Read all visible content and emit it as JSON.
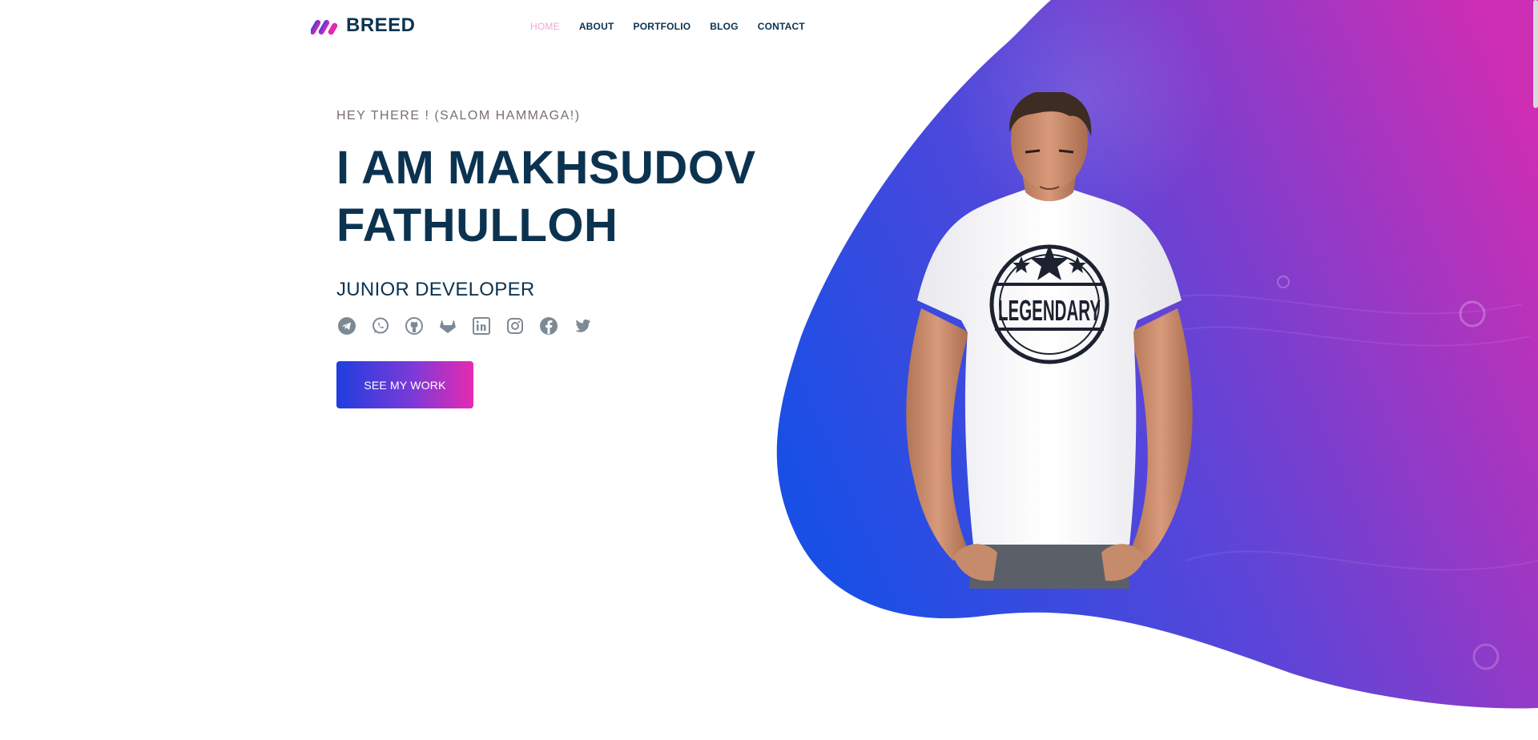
{
  "brand": {
    "name": "BREED",
    "logo_icon": "brand-logo-icon"
  },
  "nav": {
    "items": [
      {
        "label": "HOME",
        "active": true
      },
      {
        "label": "ABOUT",
        "active": false
      },
      {
        "label": "PORTFOLIO",
        "active": false
      },
      {
        "label": "BLOG",
        "active": false
      },
      {
        "label": "CONTACT",
        "active": false
      }
    ]
  },
  "hero": {
    "greeting": "HEY THERE ! (SALOM HAMMAGA!)",
    "name_line1": "I AM MAKHSUDOV",
    "name_line2": "FATHULLOH",
    "role": "JUNIOR DEVELOPER",
    "cta_label": "SEE MY WORK",
    "socials": [
      "telegram-icon",
      "whatsapp-icon",
      "github-icon",
      "gitlab-icon",
      "linkedin-icon",
      "instagram-icon",
      "facebook-icon",
      "twitter-icon"
    ]
  },
  "portrait": {
    "shirt_text": "LEGENDARY"
  },
  "colors": {
    "heading": "#0b3350",
    "active_nav": "#f2a6d8",
    "blob_start": "#1a4fe6",
    "blob_end": "#c92fb4",
    "icon": "#7d8a95"
  }
}
